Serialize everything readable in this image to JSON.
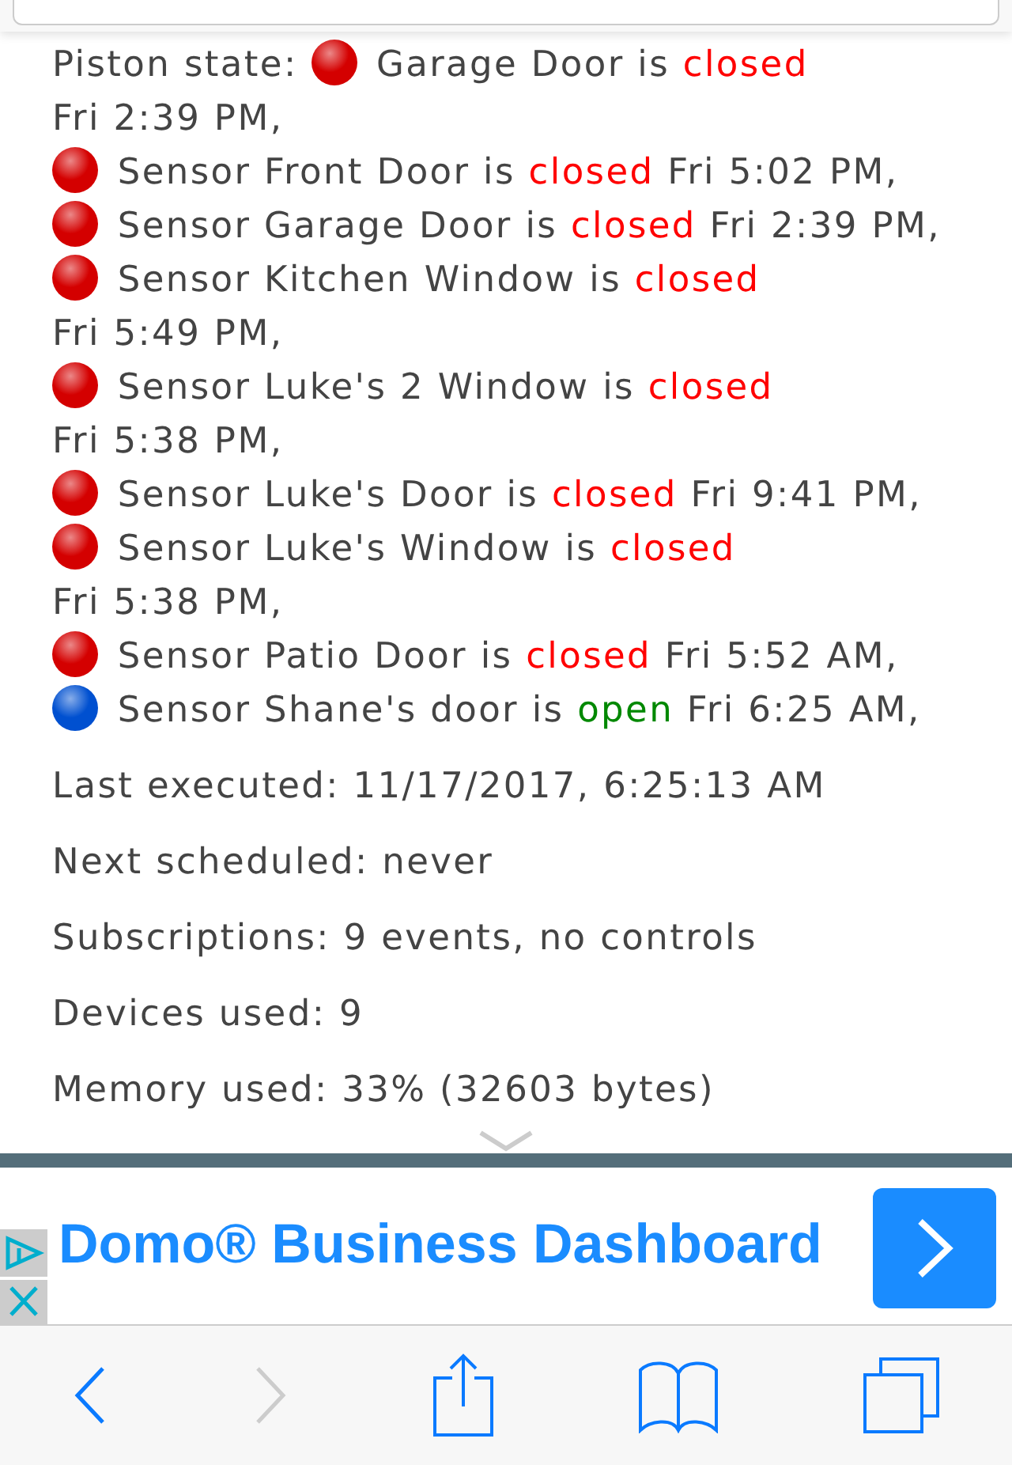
{
  "piston_state": {
    "label": "Piston state:",
    "entries": [
      {
        "color": "#d40000",
        "device": "Garage Door is",
        "status": "closed",
        "open": false,
        "time": "Fri 2:39 PM,"
      },
      {
        "color": "#d40000",
        "device": "Sensor Front Door is",
        "status": "closed",
        "open": false,
        "time": "Fri 5:02 PM,"
      },
      {
        "color": "#d40000",
        "device": "Sensor Garage Door is",
        "status": "closed",
        "open": false,
        "time": "Fri 2:39 PM,"
      },
      {
        "color": "#d40000",
        "device": "Sensor Kitchen Window is",
        "status": "closed",
        "open": false,
        "time": "Fri 5:49 PM,"
      },
      {
        "color": "#d40000",
        "device": "Sensor Luke's 2 Window is",
        "status": "closed",
        "open": false,
        "time": "Fri 5:38 PM,"
      },
      {
        "color": "#d40000",
        "device": "Sensor Luke's Door is",
        "status": "closed",
        "open": false,
        "time": "Fri 9:41 PM,"
      },
      {
        "color": "#d40000",
        "device": "Sensor Luke's Window is",
        "status": "closed",
        "open": false,
        "time": "Fri 5:38 PM,"
      },
      {
        "color": "#d40000",
        "device": "Sensor Patio Door is",
        "status": "closed",
        "open": false,
        "time": "Fri 5:52 AM,"
      },
      {
        "color": "#0050d0",
        "device": "Sensor Shane's door is",
        "status": "open",
        "open": true,
        "time": "Fri 6:25 AM,"
      }
    ]
  },
  "info_lines": [
    "Last executed: 11/17/2017, 6:25:13 AM",
    "Next scheduled: never",
    "Subscriptions: 9 events, no controls",
    "Devices used: 9",
    "Memory used: 33% (32603 bytes)"
  ],
  "ad": {
    "title": "Domo® Business Dashboard"
  }
}
